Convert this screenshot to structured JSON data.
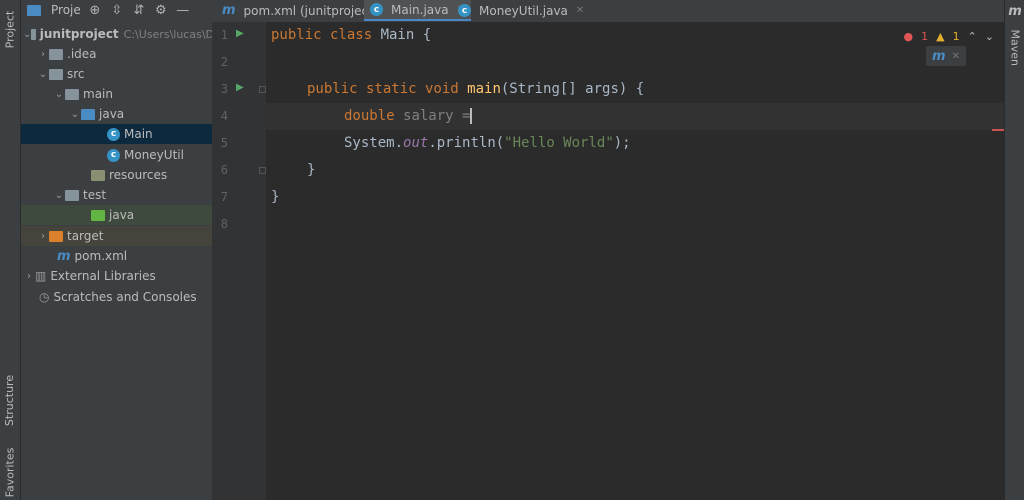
{
  "left_stripe": {
    "project_tab": "Project",
    "structure_tab": "Structure",
    "favorites_tab": "Favorites"
  },
  "project_panel": {
    "title": "Proje",
    "tree": [
      {
        "label": "junitproject",
        "path": "C:\\Users\\lucas\\D",
        "icon": "module-folder-icon"
      },
      {
        "label": ".idea",
        "icon": "folder-icon"
      },
      {
        "label": "src",
        "icon": "folder-icon"
      },
      {
        "label": "main",
        "icon": "folder-icon"
      },
      {
        "label": "java",
        "icon": "source-folder-icon"
      },
      {
        "label": "Main",
        "icon": "java-class-icon"
      },
      {
        "label": "MoneyUtil",
        "icon": "java-class-icon"
      },
      {
        "label": "resources",
        "icon": "resources-folder-icon"
      },
      {
        "label": "test",
        "icon": "folder-icon"
      },
      {
        "label": "java",
        "icon": "test-folder-icon"
      },
      {
        "label": "target",
        "icon": "excluded-folder-icon"
      },
      {
        "label": "pom.xml",
        "icon": "maven-icon"
      },
      {
        "label": "External Libraries",
        "icon": "libraries-icon"
      },
      {
        "label": "Scratches and Consoles",
        "icon": "scratches-icon"
      }
    ]
  },
  "tabs": [
    {
      "label": "pom.xml (junitproject)",
      "icon": "maven-icon"
    },
    {
      "label": "Main.java",
      "icon": "java-class-icon",
      "active": true
    },
    {
      "label": "MoneyUtil.java",
      "icon": "java-class-icon"
    }
  ],
  "editor": {
    "line_numbers": [
      "1",
      "2",
      "3",
      "4",
      "5",
      "6",
      "7",
      "8"
    ],
    "inspections": {
      "errors": "1",
      "warnings": "1"
    },
    "lines": {
      "l1_kw": "public class ",
      "l1_name": "Main {",
      "l3_kw": "public static void ",
      "l3_fn": "main",
      "l3_rest": "(String[] args) {",
      "l4_kw": "double ",
      "l4_var": "salary =",
      "l5_a": "System.",
      "l5_out": "out",
      "l5_b": ".println(",
      "l5_str": "\"Hello World\"",
      "l5_c": ");",
      "l6": "}",
      "l7": "}"
    }
  },
  "right_stripe": {
    "maven_tab": "Maven"
  },
  "colors": {
    "accent": "#4a88c7",
    "keyword": "#cc7832",
    "string": "#6a8759",
    "function": "#ffc66d",
    "error": "#e05555",
    "warning": "#e2b02d"
  }
}
